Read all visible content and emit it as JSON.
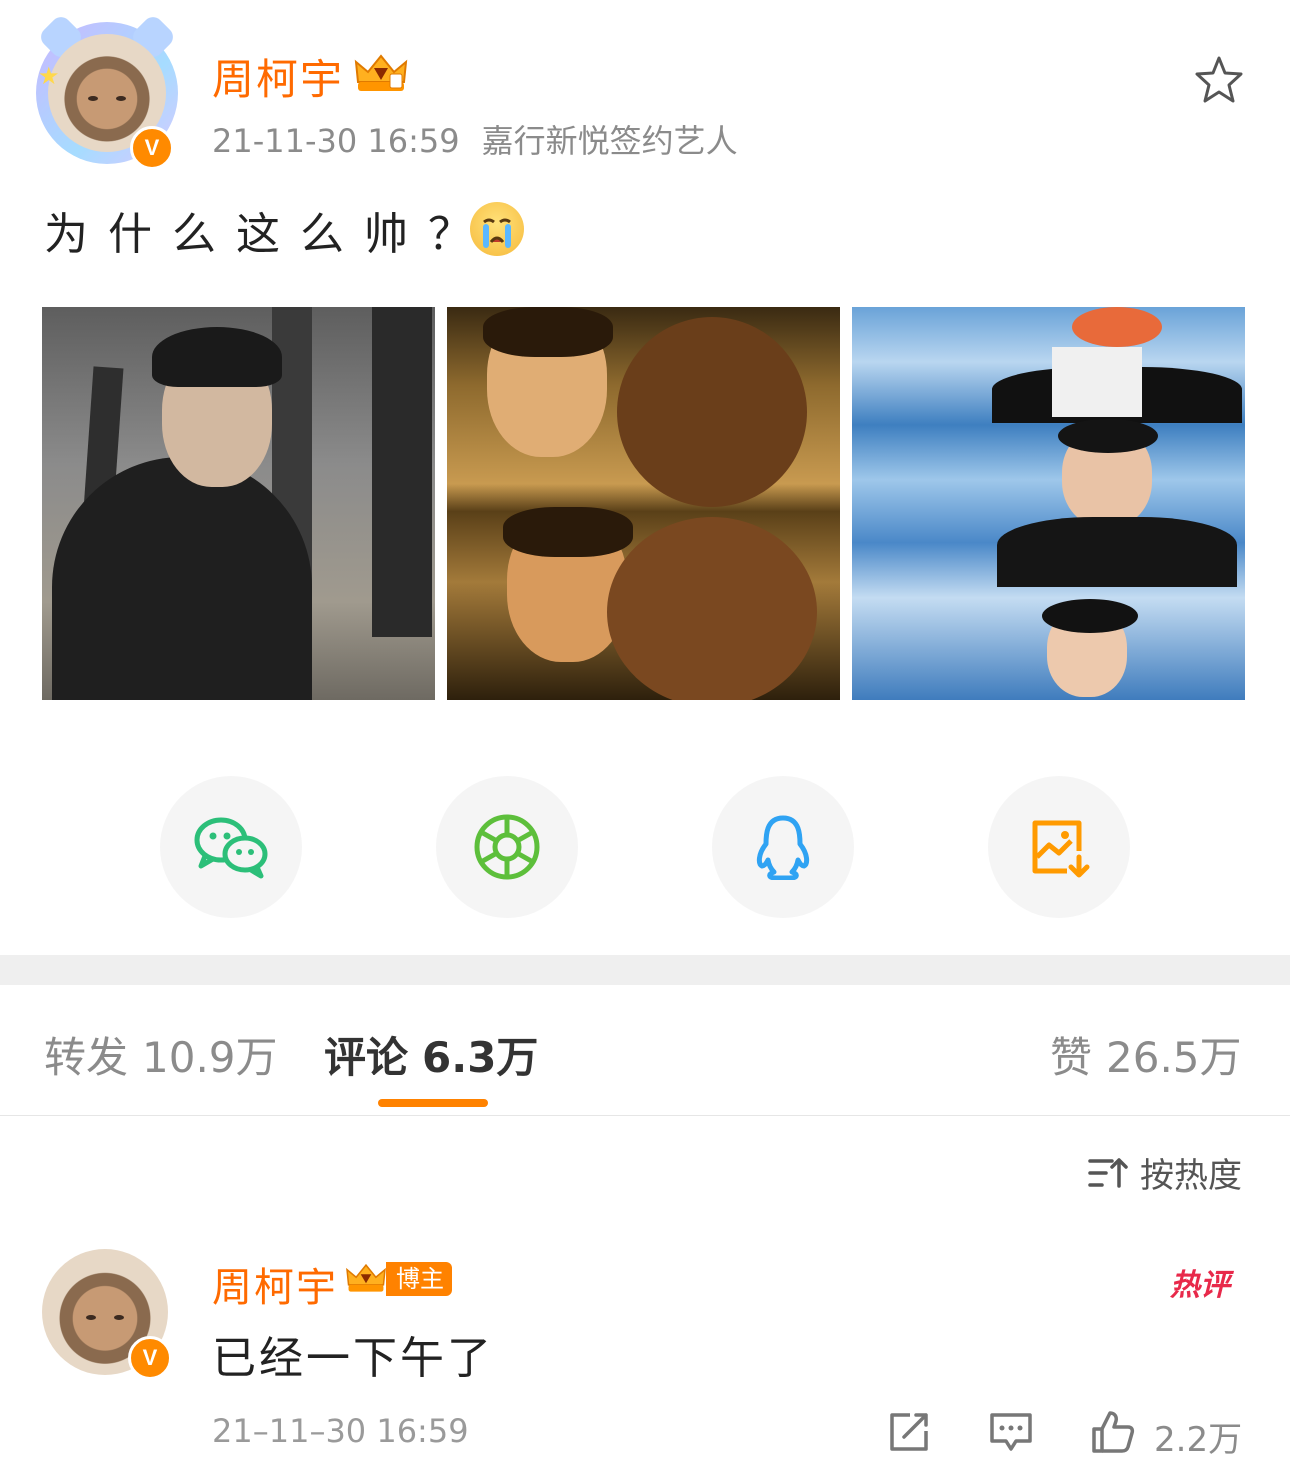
{
  "post": {
    "author": "周柯宇",
    "time": "21-11-30 16:59",
    "source": "嘉行新悦签约艺人",
    "text": "为什么这么帅？",
    "emoji_icon": "crying-face-emoji",
    "images": [
      "photo-1",
      "photo-2",
      "photo-3"
    ]
  },
  "share": [
    {
      "icon": "wechat-icon",
      "color": "#2cbf79"
    },
    {
      "icon": "moments-icon",
      "color": "#5dbf3b"
    },
    {
      "icon": "qq-icon",
      "color": "#2fa3f3"
    },
    {
      "icon": "save-image-icon",
      "color": "#ff9a00"
    }
  ],
  "tabs": {
    "repost_label": "转发",
    "repost_count": "10.9万",
    "comment_label": "评论",
    "comment_count": "6.3万",
    "like_label": "赞",
    "like_count": "26.5万"
  },
  "sort": {
    "label": "按热度"
  },
  "comment": {
    "author": "周柯宇",
    "badge": "博主",
    "hot_tag": "热评",
    "text": "已经一下午了",
    "time": "21–11–30 16:59",
    "likes": "2.2万"
  },
  "colors": {
    "accent": "#ff8200",
    "username": "#ff6a00",
    "hot": "#e8294a"
  }
}
